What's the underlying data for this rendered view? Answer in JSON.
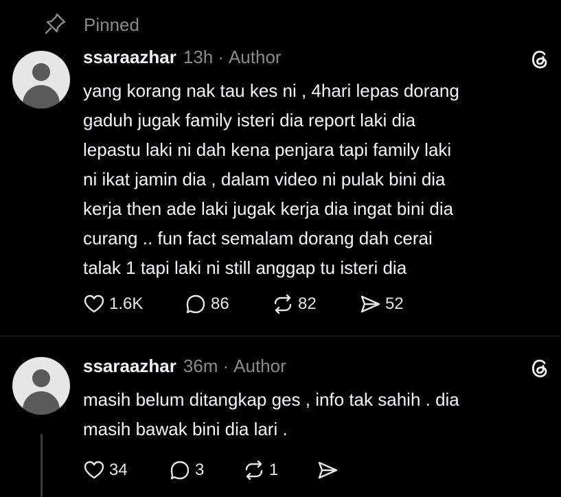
{
  "pinned": {
    "label": "Pinned",
    "icon": "pin-icon"
  },
  "posts": [
    {
      "username": "ssaraazhar",
      "time": "13h",
      "separator": "·",
      "role": "Author",
      "text": "yang korang nak tau kes ni , 4hari lepas dorang\ngaduh jugak family isteri dia report laki dia\nlepastu laki ni dah kena penjara tapi family laki\nni ikat jamin dia , dalam video ni pulak bini dia\nkerja then ade laki jugak kerja dia ingat bini dia\ncurang .. fun fact semalam dorang dah cerai\ntalak 1 tapi laki ni still anggap tu isteri dia",
      "likes": "1.6K",
      "replies": "86",
      "reposts": "82",
      "shares": "52"
    },
    {
      "username": "ssaraazhar",
      "time": "36m",
      "separator": "·",
      "role": "Author",
      "text": "masih belum ditangkap ges , info tak sahih . dia\nmasih bawak bini dia lari .",
      "likes": "34",
      "replies": "3",
      "reposts": "1",
      "shares": ""
    }
  ],
  "colors": {
    "background": "#000000",
    "text": "#f3f5f7",
    "muted": "#8a8a8a"
  }
}
